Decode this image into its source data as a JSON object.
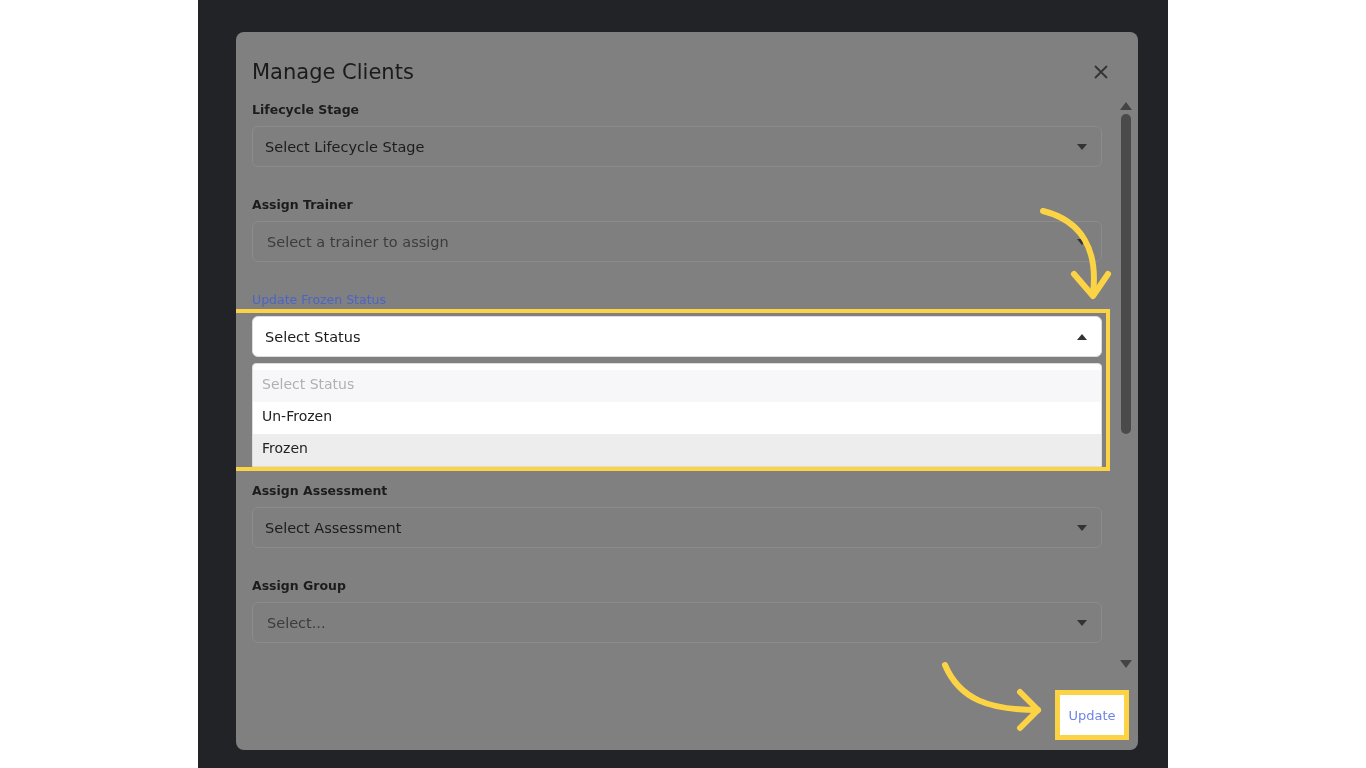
{
  "modal": {
    "title": "Manage Clients",
    "fields": [
      {
        "label": "Lifecycle Stage",
        "value": "Select Lifecycle Stage",
        "focused": false,
        "expanded": false
      },
      {
        "label": "Assign Trainer",
        "placeholder": "Select a trainer to assign",
        "focused": false,
        "expanded": false
      },
      {
        "label": "Update Frozen Status",
        "value": "Select Status",
        "focused": true,
        "expanded": true,
        "highlighted": true,
        "options": [
          {
            "label": "Select Status",
            "disabled": true,
            "focused": false
          },
          {
            "label": "Un-Frozen",
            "disabled": false,
            "focused": false
          },
          {
            "label": "Frozen",
            "disabled": false,
            "focused": true
          }
        ]
      },
      {
        "label": "Assign Assessment",
        "value": "Select Assessment",
        "focused": false,
        "expanded": false
      },
      {
        "label": "Assign Group",
        "placeholder": "Select...",
        "focused": false,
        "expanded": false
      }
    ],
    "update_button": {
      "label": "Update",
      "highlighted": true
    }
  }
}
